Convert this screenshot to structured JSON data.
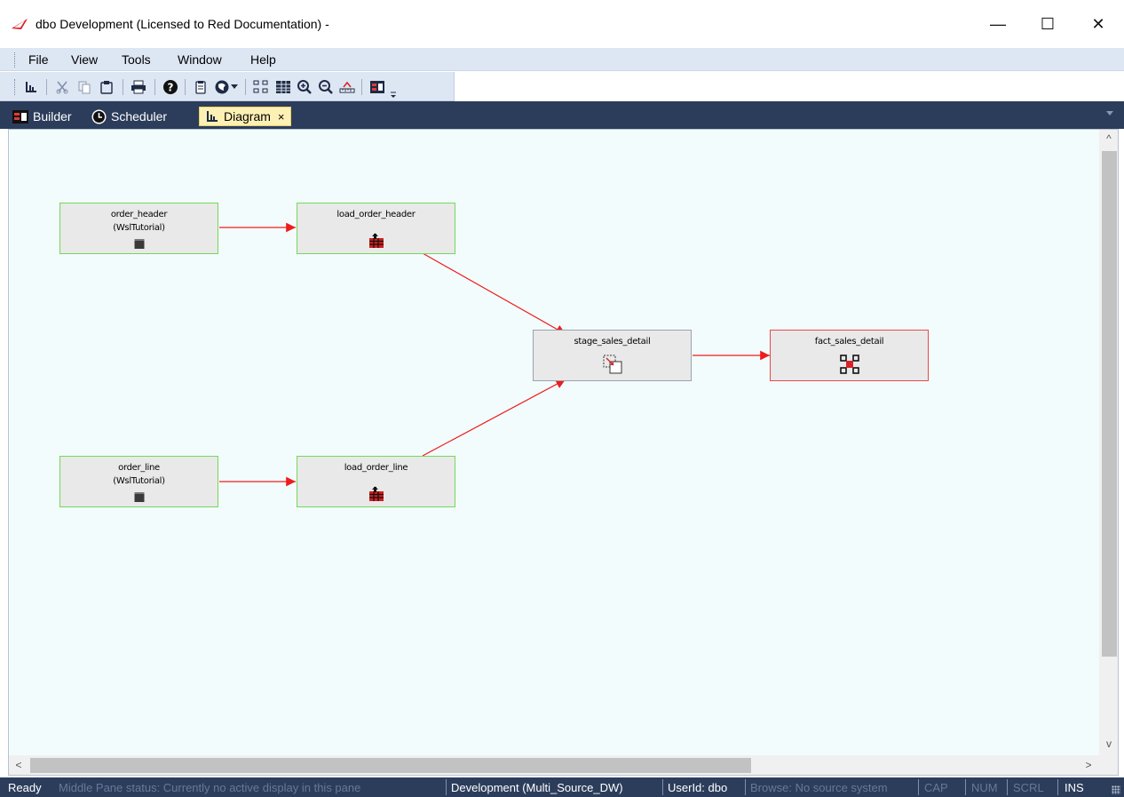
{
  "window": {
    "title": "dbo  Development  (Licensed to Red Documentation) -",
    "minimize_glyph": "—",
    "maximize_glyph": "☐",
    "close_glyph": "✕"
  },
  "menu": {
    "items": [
      "File",
      "View",
      "Tools",
      "Window",
      "Help"
    ]
  },
  "toolbar": {
    "icons": [
      "diagram-icon",
      "cut-icon",
      "copy-icon",
      "paste-icon",
      "print-icon",
      "help-icon",
      "properties-icon",
      "globe-icon",
      "dropdown-arrow-icon",
      "layout-icon",
      "grid-icon",
      "zoom-in-icon",
      "zoom-out-icon",
      "ruler-icon",
      "builder-icon",
      "overflow-icon"
    ]
  },
  "tabs": {
    "builder": "Builder",
    "scheduler": "Scheduler",
    "diagram": "Diagram",
    "close_glyph": "×"
  },
  "diagram": {
    "nodes": {
      "order_header": {
        "name": "order_header",
        "sub": "(WslTutorial)"
      },
      "load_order_header": {
        "name": "load_order_header"
      },
      "stage_sales_detail": {
        "name": "stage_sales_detail"
      },
      "fact_sales_detail": {
        "name": "fact_sales_detail"
      },
      "order_line": {
        "name": "order_line",
        "sub": "(WslTutorial)"
      },
      "load_order_line": {
        "name": "load_order_line"
      }
    },
    "edges": [
      [
        "order_header",
        "load_order_header"
      ],
      [
        "load_order_header",
        "stage_sales_detail"
      ],
      [
        "stage_sales_detail",
        "fact_sales_detail"
      ],
      [
        "order_line",
        "load_order_line"
      ],
      [
        "load_order_line",
        "stage_sales_detail"
      ]
    ],
    "colors": {
      "edge": "#ee1c1c",
      "source_border": "#73d85a",
      "fact_border": "#e84a4a",
      "background": "#f3fcfd"
    }
  },
  "scrollbars": {
    "up": "^",
    "down": "v",
    "left": "<",
    "right": ">"
  },
  "status": {
    "ready": "Ready",
    "middle_pane": "Middle Pane status: Currently no active display in this pane",
    "connection": "Development (Multi_Source_DW)",
    "user": "UserId: dbo",
    "browse": "Browse: No source system",
    "cap": "CAP",
    "num": "NUM",
    "scrl": "SCRL",
    "ins": "INS"
  }
}
